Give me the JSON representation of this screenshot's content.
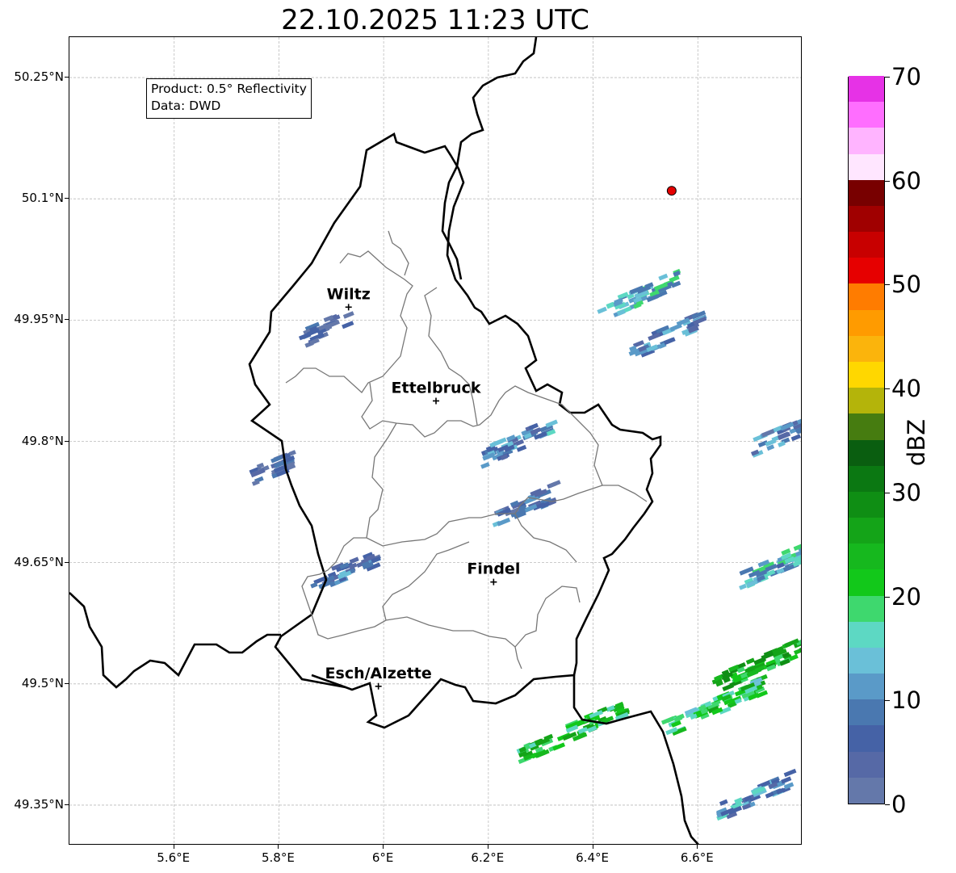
{
  "title": "22.10.2025 11:23 UTC",
  "info": {
    "product": "Product: 0.5° Reflectivity",
    "source": "Data: DWD"
  },
  "axes": {
    "lat_ticks": [
      "50.25°N",
      "50.1°N",
      "49.95°N",
      "49.8°N",
      "49.65°N",
      "49.5°N",
      "49.35°N"
    ],
    "lon_ticks": [
      "5.6°E",
      "5.8°E",
      "6°E",
      "6.2°E",
      "6.4°E",
      "6.6°E"
    ],
    "lat_values": [
      50.25,
      50.1,
      49.95,
      49.8,
      49.65,
      49.5,
      49.35
    ],
    "lon_values": [
      5.6,
      5.8,
      6.0,
      6.2,
      6.4,
      6.6
    ],
    "lat_range": [
      49.3,
      50.3
    ],
    "lon_range": [
      5.4,
      6.8
    ],
    "grid": true
  },
  "cities": [
    {
      "name": "Wiltz",
      "lat": 49.966,
      "lon": 5.933
    },
    {
      "name": "Ettelbruck",
      "lat": 49.85,
      "lon": 6.1
    },
    {
      "name": "Findel",
      "lat": 49.626,
      "lon": 6.21
    },
    {
      "name": "Esch/Alzette",
      "lat": 49.497,
      "lon": 5.99
    }
  ],
  "marker": {
    "lat": 50.11,
    "lon": 6.55,
    "color": "#e50000"
  },
  "colorbar": {
    "label": "dBZ",
    "ticks": [
      "0",
      "10",
      "20",
      "30",
      "40",
      "50",
      "60",
      "70"
    ],
    "colors": [
      "#6478aa",
      "#5669a6",
      "#4562a6",
      "#4a78b0",
      "#5a9ac8",
      "#6ac0d8",
      "#5dd8c3",
      "#3ed86e",
      "#12c81a",
      "#16b81e",
      "#14a418",
      "#0f8e14",
      "#0b7812",
      "#0a5e10",
      "#467c10",
      "#b4b40a",
      "#ffd700",
      "#fbb40c",
      "#ff9b00",
      "#ff7c00",
      "#e60000",
      "#c80000",
      "#a00000",
      "#780000",
      "#ffe6ff",
      "#ffb4ff",
      "#ff6eff",
      "#e632e6"
    ]
  },
  "radar_echoes": [
    {
      "lat": 49.94,
      "lon": 5.88,
      "dbz": 3
    },
    {
      "lat": 49.77,
      "lon": 5.79,
      "dbz": 4
    },
    {
      "lat": 49.64,
      "lon": 5.92,
      "dbz": 8
    },
    {
      "lat": 49.8,
      "lon": 6.25,
      "dbz": 10
    },
    {
      "lat": 49.72,
      "lon": 6.26,
      "dbz": 7
    },
    {
      "lat": 49.98,
      "lon": 6.48,
      "dbz": 14
    },
    {
      "lat": 49.93,
      "lon": 6.53,
      "dbz": 9
    },
    {
      "lat": 49.44,
      "lon": 6.35,
      "dbz": 22
    },
    {
      "lat": 49.47,
      "lon": 6.62,
      "dbz": 20
    },
    {
      "lat": 49.53,
      "lon": 6.73,
      "dbz": 24
    },
    {
      "lat": 49.36,
      "lon": 6.7,
      "dbz": 10
    },
    {
      "lat": 49.81,
      "lon": 6.76,
      "dbz": 8
    },
    {
      "lat": 49.65,
      "lon": 6.75,
      "dbz": 13
    }
  ]
}
